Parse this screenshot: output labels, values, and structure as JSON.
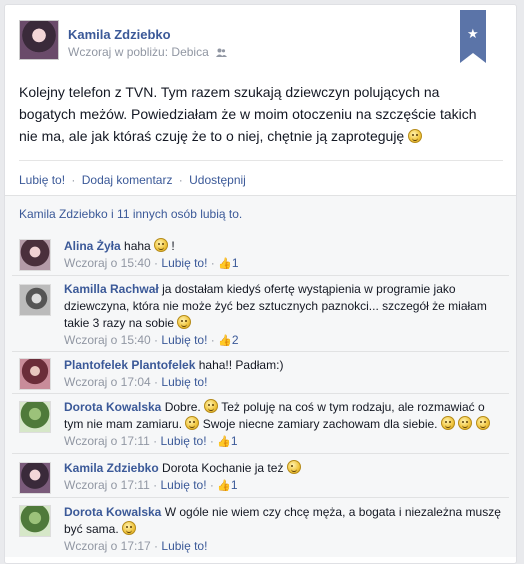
{
  "post": {
    "author": "Kamila Zdziebko",
    "time": "Wczoraj",
    "near_prefix": "w pobliżu:",
    "location": "Debica",
    "text": "Kolejny telefon z TVN. Tym razem szukają dziewczyn polujących na bogatych meżów. Powiedziałam że w moim otoczeniu na szczęście takich nie ma, ale jak któraś czuję że to o niej, chętnie ją zaproteguję"
  },
  "actions": {
    "like": "Lubię to!",
    "comment": "Dodaj komentarz",
    "share": "Udostępnij",
    "separator": "·"
  },
  "likes_summary": "Kamila Zdziebko i 11 innych osób lubią to.",
  "comments": [
    {
      "name": "Alina Żyła",
      "text": "haha",
      "suffix": "!",
      "time": "Wczoraj o 15:40",
      "like": "Lubię to!",
      "likes": "1"
    },
    {
      "name": "Kamilla Rachwał",
      "text": "ja dostałam kiedyś ofertę wystąpienia w programie jako dziewczyna, która nie może żyć bez sztucznych paznokci... szczegół że miałam takie 3 razy na sobie",
      "suffix": "",
      "time": "Wczoraj o 15:40",
      "like": "Lubię to!",
      "likes": "2"
    },
    {
      "name": "Plantofelek Plantofelek",
      "text": "haha!! Padłam:)",
      "suffix": "",
      "time": "Wczoraj o 17:04",
      "like": "Lubię to!",
      "likes": ""
    },
    {
      "name": "Dorota Kowalska",
      "text": "Dobre.",
      "text2": "Też poluję na coś w tym rodzaju, ale rozmawiać o tym nie mam zamiaru.",
      "text3": "Swoje niecne zamiary zachowam dla siebie.",
      "suffix": "",
      "time": "Wczoraj o 17:11",
      "like": "Lubię to!",
      "likes": "1"
    },
    {
      "name": "Kamila Zdziebko",
      "text": "Dorota Kochanie ja też",
      "suffix": "",
      "time": "Wczoraj o 17:11",
      "like": "Lubię to!",
      "likes": "1"
    },
    {
      "name": "Dorota Kowalska",
      "text": "W ogóle nie wiem czy chcę męża, a bogata i niezależna muszę być sama.",
      "suffix": "",
      "time": "Wczoraj o 17:17",
      "like": "Lubię to!",
      "likes": ""
    }
  ],
  "icons": {
    "bookmark": "star-icon",
    "audience": "friends-icon",
    "like": "thumbs-up-icon",
    "emoticon": "smile-icon"
  },
  "colors": {
    "link": "#3b5998",
    "meta": "#9197a3",
    "bookmark": "#5b74a8"
  }
}
